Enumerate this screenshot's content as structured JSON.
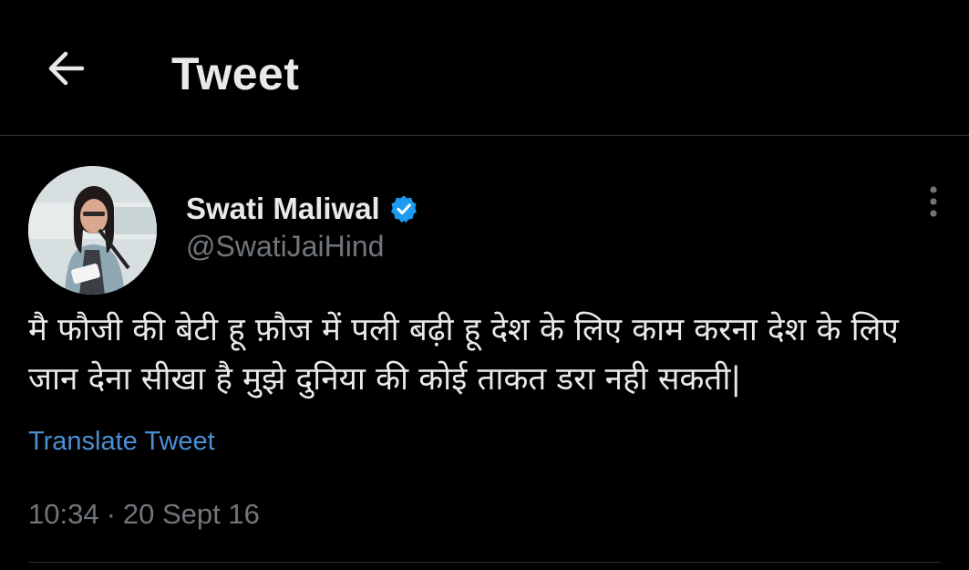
{
  "header": {
    "back_icon": "arrow-left-icon",
    "title": "Tweet"
  },
  "tweet": {
    "author": {
      "name": "Swati Maliwal",
      "handle": "@SwatiJaiHind",
      "verified": true,
      "verified_color": "#1d9bf0"
    },
    "text": "मै फौजी की बेटी हू फ़ौज में पली बढ़ी हू देश के लिए काम करना देश के लिए जान देना सीखा है मुझे दुनिया की कोई ताकत डरा नही सकती|",
    "translate_label": "Translate Tweet",
    "time": "10:34",
    "separator": "·",
    "date": "20 Sept 16",
    "more_icon": "more-vertical-icon"
  },
  "colors": {
    "background": "#000000",
    "text_primary": "#e7e9ea",
    "text_secondary": "#71767b",
    "link": "#4a8fd4",
    "divider": "#2f3336"
  }
}
